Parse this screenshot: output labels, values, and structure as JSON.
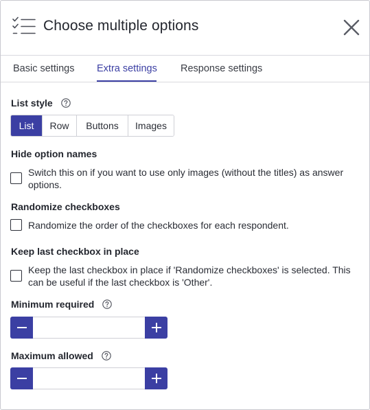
{
  "header": {
    "title": "Choose multiple options"
  },
  "tabs": [
    {
      "label": "Basic settings"
    },
    {
      "label": "Extra settings"
    },
    {
      "label": "Response settings"
    }
  ],
  "list_style": {
    "label": "List style",
    "options": [
      "List",
      "Row",
      "Buttons",
      "Images"
    ],
    "selected": "List"
  },
  "hide_option_names": {
    "label": "Hide option names",
    "text": "Switch this on if you want to use only images (without the titles) as answer options."
  },
  "randomize": {
    "label": "Randomize checkboxes",
    "text": "Randomize the order of the checkboxes for each respondent."
  },
  "keep_last": {
    "label": "Keep last checkbox in place",
    "text": "Keep the last checkbox in place if 'Randomize checkboxes' is selected. This can be useful if the last checkbox is 'Other'."
  },
  "minimum": {
    "label": "Minimum required",
    "value": ""
  },
  "maximum": {
    "label": "Maximum allowed",
    "value": ""
  },
  "colors": {
    "accent": "#3b3fa3",
    "border": "#cfd0d6"
  },
  "icons": {
    "header": "checklist-icon",
    "close": "close-icon",
    "help": "help-icon",
    "minus": "minus-icon",
    "plus": "plus-icon"
  }
}
